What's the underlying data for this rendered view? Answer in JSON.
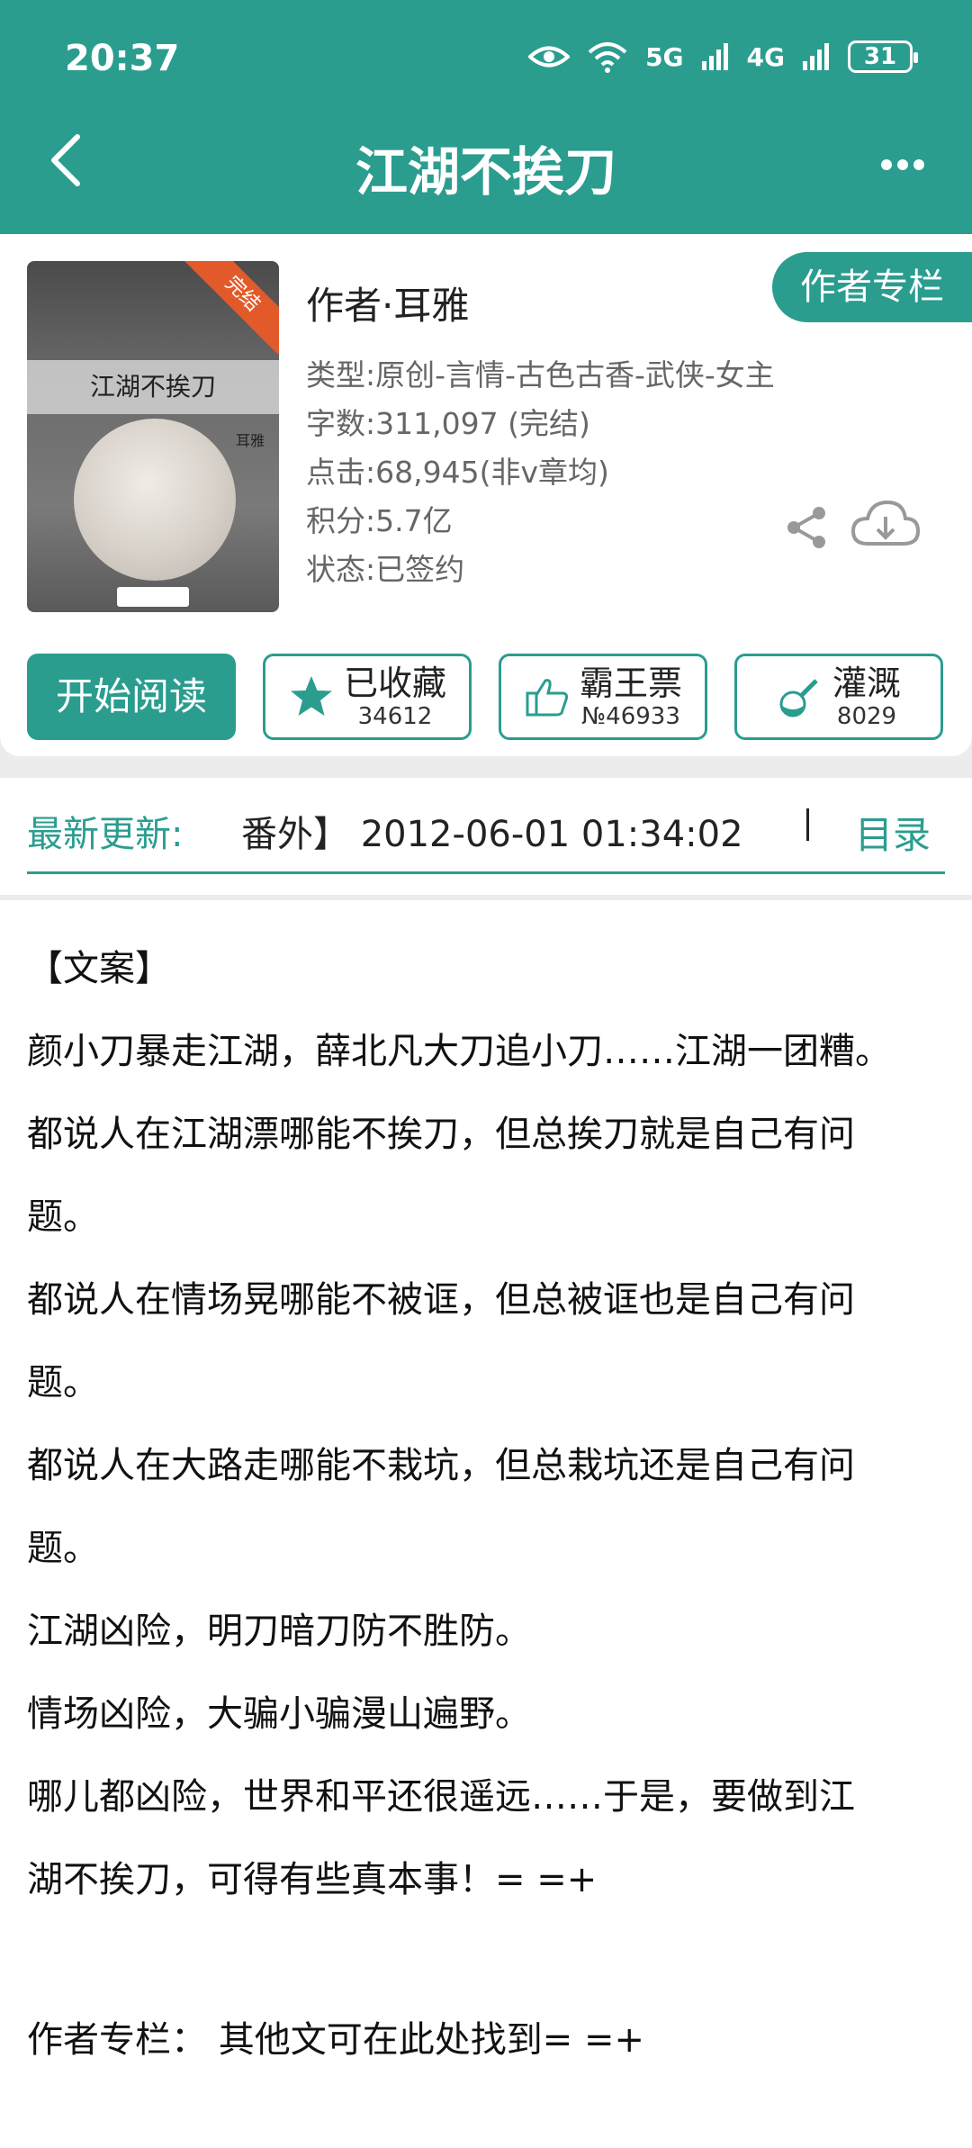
{
  "status_bar": {
    "time": "20:37",
    "network_1": "5G",
    "network_2": "4G",
    "battery": "31"
  },
  "nav": {
    "title": "江湖不挨刀",
    "back_icon": "chevron-left-icon",
    "more_icon": "more-horizontal-icon"
  },
  "book": {
    "cover_title": "江湖不挨刀",
    "cover_author": "耳雅",
    "cover_badge": "完结",
    "author_line": "作者·耳雅",
    "author_column_button": "作者专栏",
    "meta": [
      {
        "key": "类型: ",
        "value": "原创-言情-古色古香-武侠-女主"
      },
      {
        "key": "字数: ",
        "value": "311,097 (完结)"
      },
      {
        "key": "点击: ",
        "value": "68,945(非v章均)"
      },
      {
        "key": "积分: ",
        "value": "5.7亿"
      },
      {
        "key": "状态: ",
        "value": "已签约"
      }
    ]
  },
  "actions": {
    "read": "开始阅读",
    "collect": {
      "label": "已收藏",
      "count": "34612",
      "icon": "star-icon"
    },
    "ticket": {
      "label": "霸王票",
      "count": "№46933",
      "icon": "thumbs-up-icon"
    },
    "nutrient": {
      "label": "灌溉",
      "count": "8029",
      "icon": "flask-icon"
    }
  },
  "update": {
    "label": "最新更新:",
    "text": "番外】 2012-06-01 01:34:02",
    "toc": "目录"
  },
  "description": {
    "lines": [
      "【文案】",
      "颜小刀暴走江湖，薛北凡大刀追小刀……江湖一团糟。",
      "都说人在江湖漂哪能不挨刀，但总挨刀就是自己有问",
      "题。",
      "都说人在情场晃哪能不被诓，但总被诓也是自己有问",
      "题。",
      "都说人在大路走哪能不栽坑，但总栽坑还是自己有问",
      "题。",
      "江湖凶险，明刀暗刀防不胜防。",
      "情场凶险，大骗小骗漫山遍野。",
      "哪儿都凶险，世界和平还很遥远……于是，要做到江",
      "湖不挨刀，可得有些真本事！= =+"
    ],
    "footer": "作者专栏： 其他文可在此处找到= =+"
  },
  "colors": {
    "accent": "#2a9d8f",
    "badge": "#e35a2a"
  }
}
